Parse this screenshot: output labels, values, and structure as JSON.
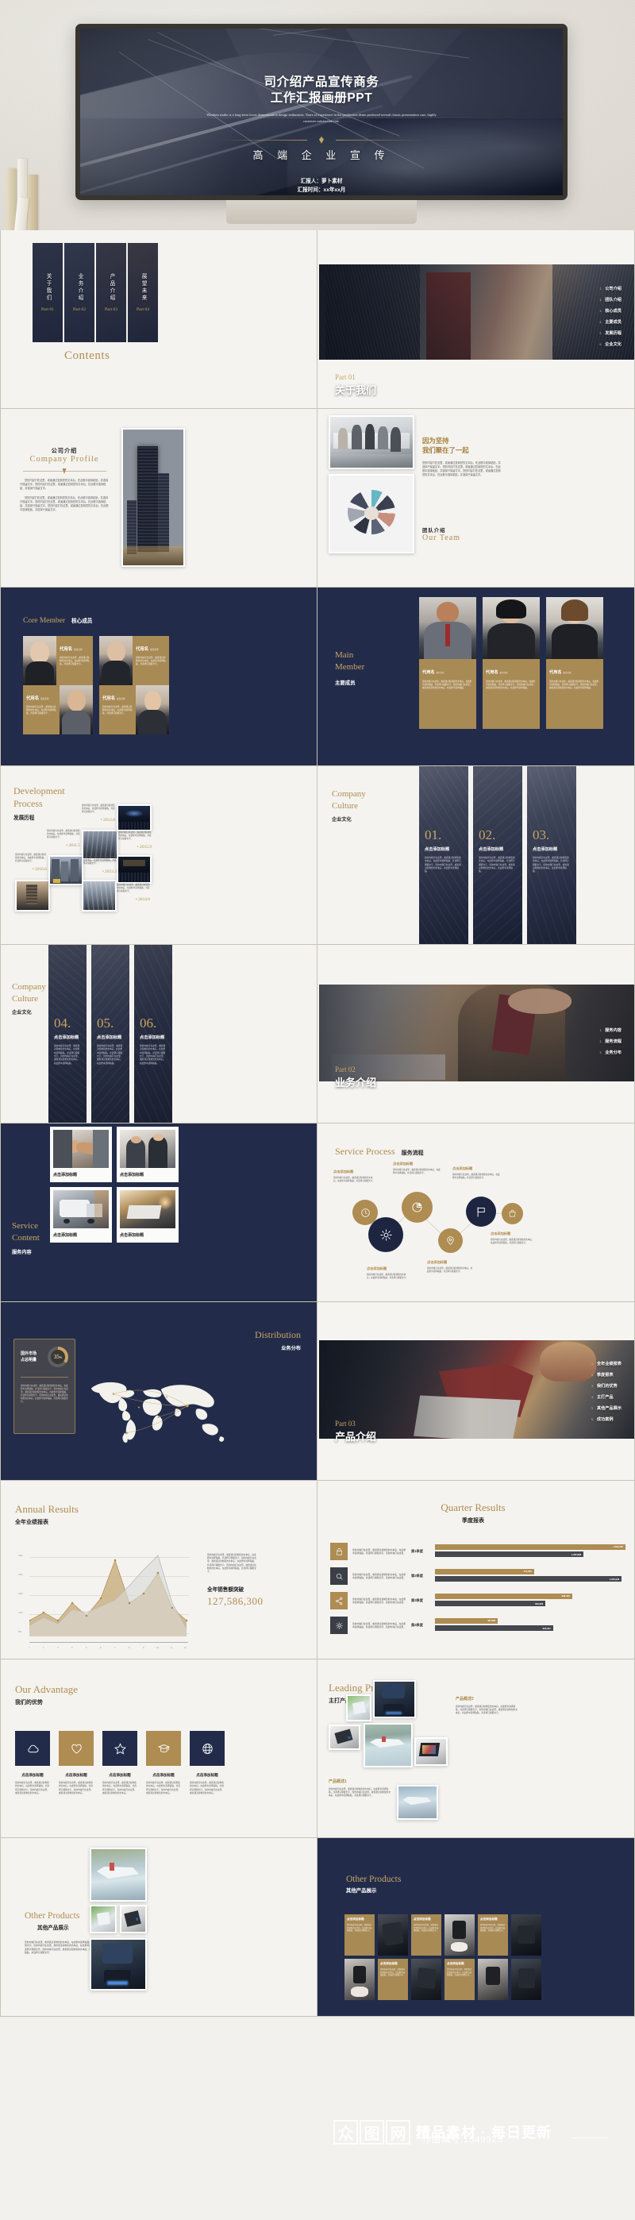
{
  "hero": {
    "title_line1": "司介绍产品宣传商务",
    "title_line2": "工作汇报画册PPT",
    "subtitle": "Windsen studio is a long-term focus demonstration design enthusiasts. Years of experience in the production demo produced several classic presentation case, highly customer satisfaction rate.",
    "headline": "高 端 企 业 宣 传",
    "reporter": "汇报人：萝卜素材",
    "report_time": "汇报时间：xx年xx月"
  },
  "contents": {
    "title": "Contents",
    "cards": [
      {
        "label": "关于我们",
        "part": "Part 01"
      },
      {
        "label": "业务介绍",
        "part": "Part 02"
      },
      {
        "label": "产品介绍",
        "part": "Part 03"
      },
      {
        "label": "展望未来",
        "part": "Part 04"
      }
    ]
  },
  "part01": {
    "part": "Part 01",
    "title": "关于我们",
    "items": [
      {
        "n": "1.",
        "t": "公司介绍"
      },
      {
        "n": "2.",
        "t": "团队介绍"
      },
      {
        "n": "3.",
        "t": "核心成员"
      },
      {
        "n": "4.",
        "t": "主要成员"
      },
      {
        "n": "5.",
        "t": "发展历程"
      },
      {
        "n": "6.",
        "t": "企业文化"
      }
    ]
  },
  "company_profile": {
    "title_cn": "公司介绍",
    "title_en": "Company  Profile",
    "para1": "您的内容打在这里，或者通过复制您的文本后，在此框中选择粘贴，并选择只保留文字。您的内容打在这里，或者通过复制您的文本后，在此框中选择粘贴，并选择只保留文字。",
    "para2": "您的内容打在这里，或者通过复制您的文本后，在此框中选择粘贴，并选择只保留文字。您的内容打在这里，或者通过复制您的文本后，在此框中选择粘贴，并选择只保留文字。您的内容打在这里，或者通过复制您的文本后，在此框中选择粘贴，并选择只保留文字。"
  },
  "our_team": {
    "headline1": "因为坚持",
    "headline2": "我们聚在了一起",
    "body": "您的内容打在这里，或者通过复制您的文本后，在此框中选择粘贴，并选择只保留文字。您的内容打在这里，或者通过复制您的文本后，在此框中选择粘贴，并选择只保留文字。您的内容打在这里，或者通过复制您的文本后，在此框中选择粘贴，并选择只保留文字。",
    "title_cn": "团队介绍",
    "title_en": "Our Team"
  },
  "core_member": {
    "title_en": "Core Member",
    "title_cn": "核心成员",
    "members": [
      {
        "name": "代用名",
        "role": "职位名称",
        "desc": "您的内容打在这里，或者通过复制您的文本后，在此框中选择粘贴，并选择只保留文字。"
      },
      {
        "name": "代用名",
        "role": "职位名称",
        "desc": "您的内容打在这里，或者通过复制您的文本后，在此框中选择粘贴，并选择只保留文字。"
      },
      {
        "name": "代用名",
        "role": "职位名称",
        "desc": "您的内容打在这里，或者通过复制您的文本后，在此框中选择粘贴，并选择只保留文字。"
      },
      {
        "name": "代用名",
        "role": "职位名称",
        "desc": "您的内容打在这里，或者通过复制您的文本后，在此框中选择粘贴，并选择只保留文字。"
      }
    ]
  },
  "main_member": {
    "title_en_1": "Main",
    "title_en_2": "Member",
    "title_cn": "主要成员",
    "members": [
      {
        "name": "代用名",
        "role": "职位名称",
        "desc": "您的内容打在这里，或者通过复制您的文本后，在此框中选择粘贴，并选择只保留文字。您的内容打在这里，或者通过复制您的文本后，在此框中选择粘贴。"
      },
      {
        "name": "代用名",
        "role": "职位名称",
        "desc": "您的内容打在这里，或者通过复制您的文本后，在此框中选择粘贴，并选择只保留文字。您的内容打在这里，或者通过复制您的文本后，在此框中选择粘贴。"
      },
      {
        "name": "代用名",
        "role": "职位名称",
        "desc": "您的内容打在这里，或者通过复制您的文本后，在此框中选择粘贴，并选择只保留文字。您的内容打在这里，或者通过复制您的文本后，在此框中选择粘贴。"
      }
    ]
  },
  "development": {
    "title_en_1": "Development",
    "title_en_2": "Process",
    "title_cn": "发展历程",
    "nodes": [
      {
        "year": "2010.6",
        "desc": "您的内容打在这里，或者通过复制您的文本后，在此框中选择粘贴，并选择只保留文字。"
      },
      {
        "year": "2011.5",
        "desc": "您的内容打在这里，或者通过复制您的文本后，在此框中选择粘贴，并选择只保留文字。"
      },
      {
        "year": "2012.8",
        "desc": "您的内容打在这里，或者通过复制您的文本后，在此框中选择粘贴，并选择只保留文字。"
      },
      {
        "year": "2013.3",
        "desc": "您的内容打在这里，或者通过复制您的文本后，在此框中选择粘贴，并选择只保留文字。"
      },
      {
        "year": "2014.6",
        "desc": "您的内容打在这里，或者通过复制您的文本后，在此框中选择粘贴，并选择只保留文字。"
      },
      {
        "year": "2015.9",
        "desc": "您的内容打在这里，或者通过复制您的文本后，在此框中选择粘贴，并选择只保留文字。"
      }
    ]
  },
  "culture_a": {
    "title_en_1": "Company",
    "title_en_2": "Culture",
    "title_cn": "企业文化",
    "cards": [
      {
        "num": "01.",
        "title": "点击添加标题",
        "desc": "您的内容打在这里，或者通过复制您的文本后，在此框中选择粘贴，并选择只保留文字。您的内容打在这里，或者通过复制您的文本后，在此框中选择粘贴。"
      },
      {
        "num": "02.",
        "title": "点击添加标题",
        "desc": "您的内容打在这里，或者通过复制您的文本后，在此框中选择粘贴，并选择只保留文字。您的内容打在这里，或者通过复制您的文本后，在此框中选择粘贴。"
      },
      {
        "num": "03.",
        "title": "点击添加标题",
        "desc": "您的内容打在这里，或者通过复制您的文本后，在此框中选择粘贴，并选择只保留文字。您的内容打在这里，或者通过复制您的文本后，在此框中选择粘贴。"
      }
    ]
  },
  "culture_b": {
    "title_en_1": "Company",
    "title_en_2": "Culture",
    "title_cn": "企业文化",
    "cards": [
      {
        "num": "04.",
        "title": "点击添加标题",
        "desc": "您的内容打在这里，或者通过复制您的文本后，在此框中选择粘贴，并选择只保留文字。您的内容打在这里，或者通过复制您的文本后，在此框中选择粘贴。"
      },
      {
        "num": "05.",
        "title": "点击添加标题",
        "desc": "您的内容打在这里，或者通过复制您的文本后，在此框中选择粘贴，并选择只保留文字。您的内容打在这里，或者通过复制您的文本后，在此框中选择粘贴。"
      },
      {
        "num": "06.",
        "title": "点击添加标题",
        "desc": "您的内容打在这里，或者通过复制您的文本后，在此框中选择粘贴，并选择只保留文字。您的内容打在这里，或者通过复制您的文本后，在此框中选择粘贴。"
      }
    ]
  },
  "part02": {
    "part": "Part 02",
    "title": "业务介绍",
    "items": [
      {
        "n": "1.",
        "t": "服务内容"
      },
      {
        "n": "2.",
        "t": "服务流程"
      },
      {
        "n": "3.",
        "t": "业务分布"
      }
    ]
  },
  "service_content": {
    "title_en_1": "Service",
    "title_en_2": "Content",
    "title_cn": "服务内容",
    "cards": [
      {
        "caption": "点击添加标题"
      },
      {
        "caption": "点击添加标题"
      },
      {
        "caption": "点击添加标题"
      },
      {
        "caption": "点击添加标题"
      }
    ]
  },
  "service_process": {
    "title_en": "Service Process",
    "title_cn": "服务流程",
    "steps": [
      {
        "icon": "clock-icon",
        "title": "点击添加标题",
        "desc": "您的内容打在这里，或者通过复制您的文本后，在此框中选择粘贴，并选择只保留文字。"
      },
      {
        "icon": "gear-icon",
        "title": "点击添加标题",
        "desc": "您的内容打在这里，或者通过复制您的文本后，在此框中选择粘贴，并选择只保留文字。"
      },
      {
        "icon": "pie-chart-icon",
        "title": "点击添加标题",
        "desc": "您的内容打在这里，或者通过复制您的文本后，在此框中选择粘贴，并选择只保留文字。"
      },
      {
        "icon": "map-pin-icon",
        "title": "点击添加标题",
        "desc": "您的内容打在这里，或者通过复制您的文本后，在此框中选择粘贴，并选择只保留文字。"
      },
      {
        "icon": "flag-icon",
        "title": "点击添加标题",
        "desc": "您的内容打在这里，或者通过复制您的文本后，在此框中选择粘贴，并选择只保留文字。"
      },
      {
        "icon": "bag-icon",
        "title": "点击添加标题",
        "desc": "您的内容打在这里，或者通过复制您的文本后，在此框中选择粘贴，并选择只保留文字。"
      }
    ]
  },
  "distribution": {
    "title_en": "Distribution",
    "title_cn": "业务分布",
    "stat_label_1": "国外市场",
    "stat_label_2": "占总明量",
    "stat_value": "35",
    "stat_unit": "%",
    "desc": "您的内容打在这里，或者通过复制您的文本后，在此框中选择粘贴，并选择只保留文字。您的内容打在这里，或者通过复制您的文本后，在此框中选择粘贴，并选择只保留文字。您的内容打在这里，或者通过复制您的文本后，在此框中选择粘贴，并选择只保留文字。"
  },
  "part03": {
    "part": "Part 03",
    "title": "产品介绍",
    "items": [
      {
        "n": "1.",
        "t": "全年业绩报表"
      },
      {
        "n": "2.",
        "t": "季度报表"
      },
      {
        "n": "3.",
        "t": "我们的优势"
      },
      {
        "n": "4.",
        "t": "主打产品"
      },
      {
        "n": "5.",
        "t": "其他产品展示"
      },
      {
        "n": "6.",
        "t": "成功案例"
      }
    ]
  },
  "annual": {
    "title_en": "Annual Results",
    "title_cn": "全年业绩报表",
    "desc": "您的内容打在这里，或者通过复制您的文本后，在此框中选择粘贴，并选择只保留文字。您的内容打在这里，或者通过复制您的文本后，在此框中选择粘贴，并选择只保留文字。您的内容打在这里，或者通过复制您的文本后，在此框中选择粘贴，并选择只保留文字。",
    "kpi_label": "全年销售额突破",
    "kpi_value": "127,586,300"
  },
  "quarter": {
    "title_en": "Quarter Results",
    "title_cn": "季度报表",
    "rows": [
      {
        "icon": "lock-icon",
        "icon_style": "g",
        "text": "您的内容打在这里，或者通过复制您的文本后，在此框中选择粘贴，并选择只保留文字。您的内容打在这里。",
        "label": "第1季度"
      },
      {
        "icon": "search-icon",
        "icon_style": "d",
        "text": "您的内容打在这里，或者通过复制您的文本后，在此框中选择粘贴，并选择只保留文字。您的内容打在这里。",
        "label": "第2季度"
      },
      {
        "icon": "share-icon",
        "icon_style": "g",
        "text": "您的内容打在这里，或者通过复制您的文本后，在此框中选择粘贴，并选择只保留文字。您的内容打在这里。",
        "label": "第3季度"
      },
      {
        "icon": "gear-icon",
        "icon_style": "d",
        "text": "您的内容打在这里，或者通过复制您的文本后，在此框中选择粘贴，并选择只保留文字。您的内容打在这里。",
        "label": "第4季度"
      }
    ]
  },
  "advantage": {
    "title_en": "Our Advantage",
    "title_cn": "我们的优势",
    "items": [
      {
        "icon": "cloud-icon",
        "style": "d",
        "caption": "点击添加标题",
        "desc": "您的内容打在这里，或者通过复制您的文本后，在此框中选择粘贴，并选择只保留文字。您的内容打在这里，或者通过复制您的文本后。"
      },
      {
        "icon": "heart-icon",
        "style": "g",
        "caption": "点击添加标题",
        "desc": "您的内容打在这里，或者通过复制您的文本后，在此框中选择粘贴，并选择只保留文字。您的内容打在这里，或者通过复制您的文本后。"
      },
      {
        "icon": "star-icon",
        "style": "d",
        "caption": "点击添加标题",
        "desc": "您的内容打在这里，或者通过复制您的文本后，在此框中选择粘贴，并选择只保留文字。您的内容打在这里，或者通过复制您的文本后。"
      },
      {
        "icon": "graduation-cap-icon",
        "style": "g",
        "caption": "点击添加标题",
        "desc": "您的内容打在这里，或者通过复制您的文本后，在此框中选择粘贴，并选择只保留文字。您的内容打在这里，或者通过复制您的文本后。"
      },
      {
        "icon": "globe-icon",
        "style": "d",
        "caption": "点击添加标题",
        "desc": "您的内容打在这里，或者通过复制您的文本后，在此框中选择粘贴，并选择只保留文字。您的内容打在这里，或者通过复制您的文本后。"
      }
    ]
  },
  "leading_products": {
    "title_en": "Leading Products",
    "title_cn": "主打产品",
    "desc2_title": "产品概述2",
    "desc2": "您的内容打在这里，或者通过复制您的文本后，在此框中选择粘贴，并选择只保留文字。您的内容打在这里，或者通过复制您的文本后，在此框中选择粘贴，并选择只保留文字。",
    "desc1_title": "产品概述1",
    "desc1": "您的内容打在这里，或者通过复制您的文本后，在此框中选择粘贴，并选择只保留文字。您的内容打在这里，或者通过复制您的文本后，在此框中选择粘贴，并选择只保留文字。"
  },
  "other_products_a": {
    "title_en": "Other Products",
    "title_cn": "其他产品展示",
    "desc": "您的内容打在这里，或者通过复制您的文本后，在此框中选择粘贴，并选择只保留文字。您的内容打在这里，或者通过复制您的文本后，在此框中选择粘贴，并选择只保留文字。您的内容打在这里，或者通过复制您的文本后，在此框中选择粘贴，并选择只保留文字。"
  },
  "other_products_b": {
    "title_en": "Other Products",
    "title_cn": "其他产品展示",
    "cards": [
      {
        "title": "点击添加标题",
        "desc": "您的内容打在这里，或者通过复制您的文本后，在此框中选择粘贴，并选择只保留文字。"
      },
      {
        "title": "点击添加标题",
        "desc": "您的内容打在这里，或者通过复制您的文本后，在此框中选择粘贴，并选择只保留文字。"
      },
      {
        "title": "点击添加标题",
        "desc": "您的内容打在这里，或者通过复制您的文本后，在此框中选择粘贴，并选择只保留文字。"
      },
      {
        "title": "点击添加标题",
        "desc": "您的内容打在这里，或者通过复制您的文本后，在此框中选择粘贴，并选择只保留文字。"
      }
    ]
  },
  "watermark": {
    "brand": "众图网",
    "tagline": "精品素材 · 每日更新",
    "code": "作品编号:1549525"
  },
  "theme": {
    "navy": "#222c4a",
    "gold": "#b08d4f",
    "cream": "#f3f2ef"
  },
  "chart_data": [
    {
      "type": "area",
      "title": "全年业绩报表",
      "x": [
        "1",
        "2",
        "3",
        "4",
        "5",
        "6",
        "7",
        "8",
        "9",
        "10",
        "11",
        "12"
      ],
      "series": [
        {
          "name": "series-gold",
          "values": [
            1200,
            700,
            1500,
            900,
            1600,
            1000,
            3600,
            1500,
            1700,
            2400,
            1200,
            900
          ]
        },
        {
          "name": "series-grey",
          "values": [
            900,
            1100,
            900,
            1300,
            1200,
            1400,
            1500,
            2000,
            2600,
            4000,
            1500,
            600
          ]
        }
      ],
      "ylim": [
        0,
        4500
      ],
      "yticks": [
        500,
        1000,
        2000,
        3000,
        4500
      ],
      "xlabel": "",
      "ylabel": "",
      "grid": true,
      "legend": false
    },
    {
      "type": "bar",
      "title": "季度报表",
      "orientation": "horizontal",
      "categories": [
        "第1季度",
        "第2季度",
        "第3季度",
        "第4季度"
      ],
      "series": [
        {
          "name": "gold",
          "values": [
            1693593,
            754959,
            986406,
            427683
          ],
          "labels": [
            "1,693,593",
            "754,959",
            "986,406",
            "427,683"
          ]
        },
        {
          "name": "dark",
          "values": [
            1205888,
            1550933,
            846396,
            903221
          ],
          "labels": [
            "1,205,888",
            "1,550,933",
            "846,396",
            "903,221"
          ]
        }
      ],
      "grid": false,
      "legend": false
    },
    {
      "type": "pie",
      "title": "国外市场占总明量",
      "categories": [
        "国外市场",
        "其他"
      ],
      "values": [
        35,
        65
      ],
      "unit": "%"
    }
  ]
}
